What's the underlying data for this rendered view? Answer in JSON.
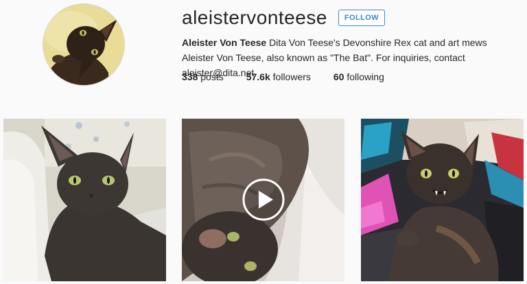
{
  "profile": {
    "username": "aleistervonteese",
    "follow_label": "FOLLOW",
    "full_name": "Aleister Von Teese",
    "bio": " Dita Von Teese's Devonshire Rex cat and art mews Aleister Von Teese, also known as \"The Bat\". For inquiries, contact aleister@dita.net"
  },
  "stats": {
    "posts_count": "338",
    "posts_label": " posts",
    "followers_count": "57.6k",
    "followers_label": " followers",
    "following_count": "60",
    "following_label": " following"
  },
  "posts": [
    {
      "type": "photo",
      "subject": "cat-on-cushion"
    },
    {
      "type": "video",
      "subject": "cat-on-bed",
      "play_icon": "play-icon"
    },
    {
      "type": "photo",
      "subject": "cat-on-clothes"
    }
  ],
  "colors": {
    "accent": "#3f86c4",
    "text": "#262626",
    "background": "#fafafa"
  }
}
